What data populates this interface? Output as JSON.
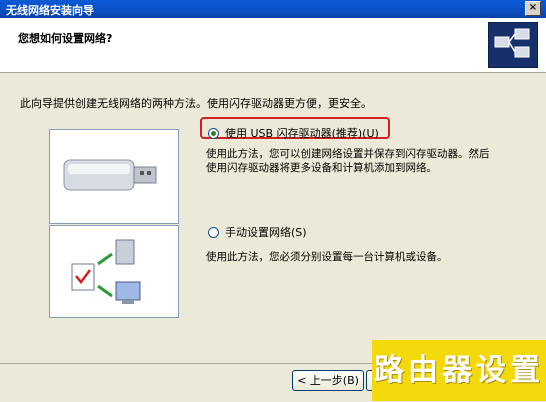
{
  "window": {
    "title": "无线网络安装向导",
    "close_label": "×"
  },
  "header": {
    "heading": "您想如何设置网络?",
    "icon": "network-wizard-icon"
  },
  "main": {
    "intro": "此向导提供创建无线网络的两种方法。使用闪存驱动器更方便，更安全。",
    "options": [
      {
        "label": "使用 USB 闪存驱动器(推荐)(U)",
        "selected": true,
        "highlighted": true,
        "description": "使用此方法，您可以创建网络设置并保存到闪存驱动器。然后使用闪存驱动器将更多设备和计算机添加到网络。",
        "image": "usb-flash-drive-icon"
      },
      {
        "label": "手动设置网络(S)",
        "selected": false,
        "description": "使用此方法，您必须分别设置每一台计算机或设备。",
        "image": "manual-network-setup-icon"
      }
    ]
  },
  "footer": {
    "back_label": "< 上一步(B)",
    "next_label": "下"
  },
  "watermark": {
    "text": "路由器设置"
  },
  "colors": {
    "titlebar": "#0a4fc3",
    "dialog_bg": "#ece9d8",
    "highlight": "#d42020",
    "watermark": "#f4d90a"
  }
}
